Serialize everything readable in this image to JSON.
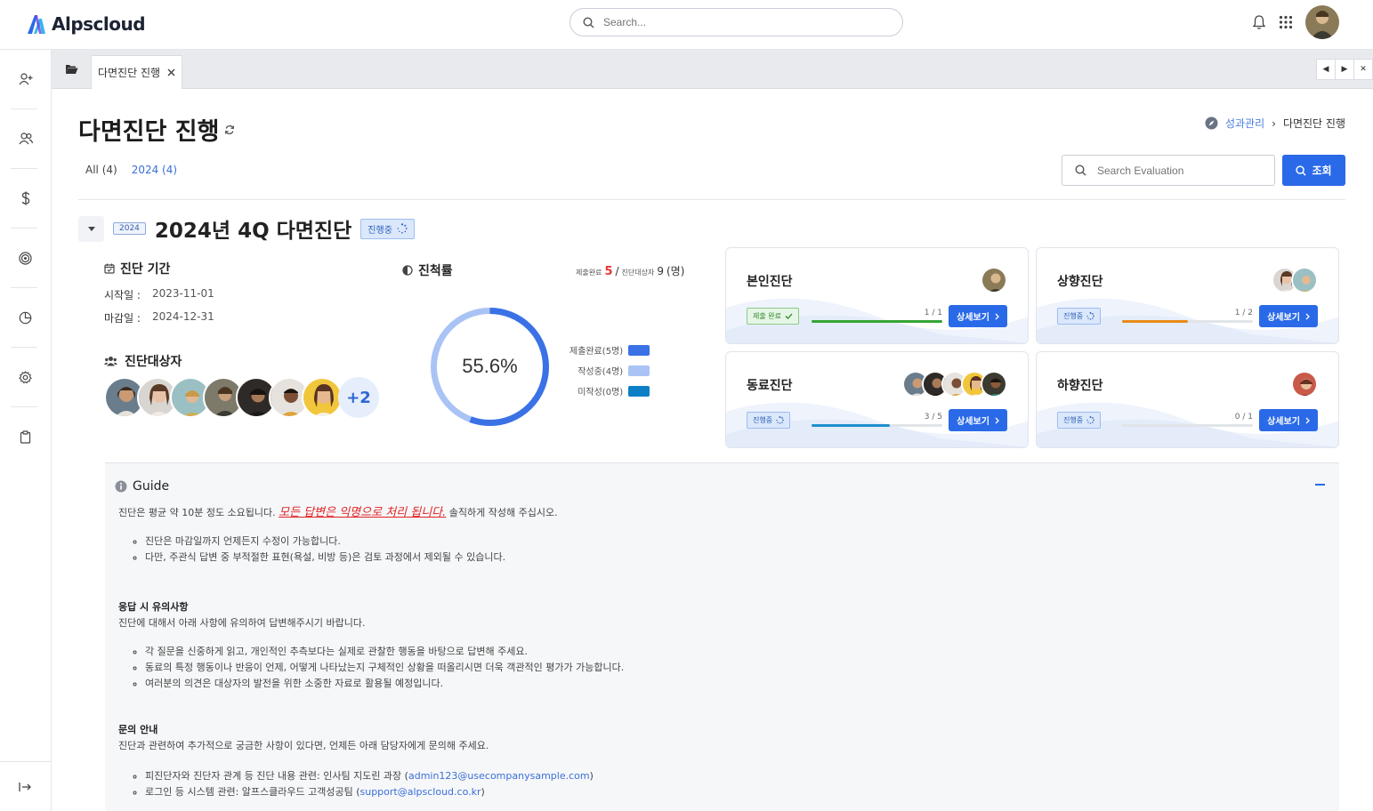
{
  "header": {
    "app_name": "Alpscloud",
    "search_placeholder": "Search..."
  },
  "tabs": {
    "active_label": "다면진단 진행"
  },
  "page": {
    "title": "다면진단 진행",
    "breadcrumb_parent": "성과관리",
    "breadcrumb_separator": "›",
    "breadcrumb_current": "다면진단 진행",
    "filter_all": "All (4)",
    "filter_2024": "2024 (4)",
    "eval_search_placeholder": "Search Evaluation",
    "search_button": "조회"
  },
  "section": {
    "year_badge": "2024",
    "title": "2024년 4Q 다면진단",
    "status": "진행중"
  },
  "period": {
    "title": "진단 기간",
    "start_label": "시작일 :",
    "start_value": "2023-11-01",
    "end_label": "마감일 :",
    "end_value": "2024-12-31"
  },
  "targets": {
    "title": "진단대상자",
    "more": "+2"
  },
  "progress": {
    "title": "진척률",
    "done_label": "제출완료",
    "done_value": "5",
    "separator": "/",
    "target_label": "진단대상자",
    "target_value": "9",
    "unit": "(명)",
    "percent_text": "55.6%",
    "percent": 55.6,
    "legend": [
      {
        "label": "제출완료(5명)",
        "color": "#3a72e6"
      },
      {
        "label": "작성중(4명)",
        "color": "#a9c3f5"
      },
      {
        "label": "미작성(0명)",
        "color": "#0d7fc7"
      }
    ]
  },
  "cards": [
    {
      "title": "본인진단",
      "badge": "제출 완료",
      "ratio": "1 / 1",
      "fraction": 1.0,
      "bar_color": "#35a535",
      "button": "상세보기"
    },
    {
      "title": "상향진단",
      "badge": "진행중",
      "ratio": "1 / 2",
      "fraction": 0.5,
      "bar_color": "#e88a1a",
      "button": "상세보기"
    },
    {
      "title": "동료진단",
      "badge": "진행중",
      "ratio": "3 / 5",
      "fraction": 0.6,
      "bar_color": "#1e8fd0",
      "button": "상세보기"
    },
    {
      "title": "하향진단",
      "badge": "진행중",
      "ratio": "0 / 1",
      "fraction": 0.0,
      "bar_color": "#1e8fd0",
      "button": "상세보기"
    }
  ],
  "guide": {
    "title": "Guide",
    "intro_before": "진단은 평균 약 10분 정도 소요됩니다.",
    "intro_warn": "모든 답변은 익명으로 처리 됩니다.",
    "intro_after": "솔직하게 작성해 주십시오.",
    "list1": [
      "진단은 마감일까지 언제든지 수정이 가능합니다.",
      "다만, 주관식 답변 중 부적절한 표현(욕설, 비방 등)은 검토 과정에서 제외될 수 있습니다."
    ],
    "sub2_title": "응답 시 유의사항",
    "sub2_text": "진단에 대해서 아래 사항에 유의하여 답변해주시기 바랍니다.",
    "list2": [
      "각 질문을 신중하게 읽고, 개인적인 추측보다는 실제로 관찰한 행동을 바탕으로 답변해 주세요.",
      "동료의 특정 행동이나 반응이 언제, 어떻게 나타났는지 구체적인 상황을 떠올리시면 더욱 객관적인 평가가 가능합니다.",
      "여러분의 의견은 대상자의 발전을 위한 소중한 자료로 활용될 예정입니다."
    ],
    "sub3_title": "문의 안내",
    "sub3_text": "진단과 관련하여 추가적으로 궁금한 사항이 있다면, 언제든 아래 담당자에게 문의해 주세요.",
    "contact1_prefix": "피진단자와 진단자 관계 등 진단 내용 관련: 인사팀 지도린 과장 (",
    "contact1_email": "admin123@usecompanysample.com",
    "contact1_suffix": ")",
    "contact2_prefix": "로그인 등 시스템 관련: 알프스클라우드 고객성공팀 (",
    "contact2_email": "support@alpscloud.co.kr",
    "contact2_suffix": ")"
  }
}
